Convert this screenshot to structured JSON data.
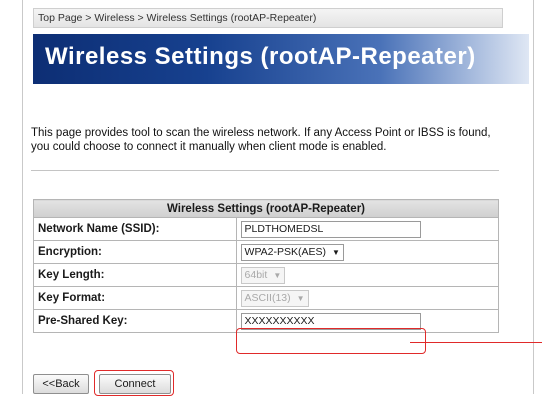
{
  "breadcrumb": "Top Page > Wireless > Wireless Settings (rootAP-Repeater)",
  "page_title": "Wireless Settings (rootAP-Repeater)",
  "description": "This page provides tool to scan the wireless network. If any Access Point or IBSS is found, you could choose to connect it manually when client mode is enabled.",
  "table": {
    "header": "Wireless Settings (rootAP-Repeater)",
    "ssid_label": "Network Name (SSID):",
    "ssid_value": "PLDTHOMEDSL",
    "encryption_label": "Encryption:",
    "encryption_value": "WPA2-PSK(AES)",
    "key_length_label": "Key Length:",
    "key_length_value": "64bit",
    "key_format_label": "Key Format:",
    "key_format_value": "ASCII(13)",
    "psk_label": "Pre-Shared Key:",
    "psk_value": "XXXXXXXXXX"
  },
  "buttons": {
    "back": "<<Back",
    "connect": "Connect"
  },
  "colors": {
    "highlight": "#e02a2a",
    "banner": "#17418f"
  }
}
